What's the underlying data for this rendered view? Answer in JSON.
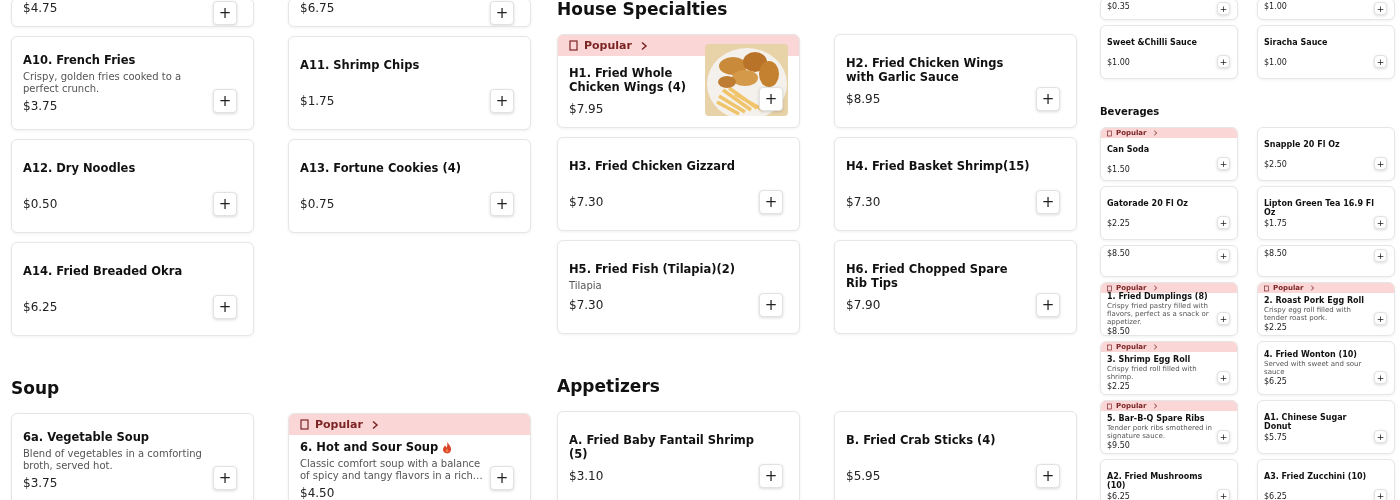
{
  "panels": [
    {
      "kind": "full",
      "sections": [
        {
          "items": [
            {
              "kind": "edge",
              "price": "$4.75",
              "button": "+"
            },
            {
              "kind": "edge",
              "price": "$6.75",
              "button": "+"
            },
            {
              "kind": "item",
              "name": "A10. French Fries",
              "description": "Crispy, golden fries cooked to a perfect crunch.",
              "price": "$3.75",
              "button": "+"
            },
            {
              "kind": "item",
              "name": "A11. Shrimp Chips",
              "price": "$1.75",
              "button": "+"
            },
            {
              "kind": "item",
              "name": "A12. Dry Noodles",
              "price": "$0.50",
              "button": "+"
            },
            {
              "kind": "item",
              "name": "A13. Fortune Cookies (4)",
              "price": "$0.75",
              "button": "+"
            },
            {
              "kind": "item",
              "name": "A14. Fried Breaded Okra",
              "price": "$6.25",
              "button": "+"
            }
          ]
        },
        {
          "heading": "Soup",
          "items": [
            {
              "name": "6a. Vegetable Soup",
              "description": "Blend of vegetables in a comforting broth, served hot.",
              "price": "$3.75",
              "button": "+"
            },
            {
              "badge": "Popular",
              "name": "6. Hot and Sour Soup",
              "spicy": true,
              "description": "Classic comfort soup with a balance of spicy and tangy flavors in a rich…",
              "price": "$4.50",
              "button": "+"
            }
          ]
        }
      ]
    },
    {
      "kind": "full",
      "sections": [
        {
          "heading": "House Specialties",
          "items": [
            {
              "badge": "Popular",
              "name": "H1. Fried Whole Chicken Wings (4)",
              "photo": true,
              "price": "$7.95",
              "button": "+"
            },
            {
              "name": "H2. Fried Chicken Wings with Garlic Sauce",
              "price": "$8.95",
              "button": "+"
            },
            {
              "name": "H3. Fried Chicken Gizzard",
              "price": "$7.30",
              "button": "+"
            },
            {
              "name": "H4. Fried Basket Shrimp(15)",
              "price": "$7.30",
              "button": "+"
            },
            {
              "name": "H5. Fried Fish (Tilapia)(2)",
              "description": "Tilapia",
              "price": "$7.30",
              "button": "+"
            },
            {
              "name": "H6. Fried Chopped Spare Rib Tips",
              "price": "$7.90",
              "button": "+"
            }
          ]
        },
        {
          "heading": "Appetizers",
          "items": [
            {
              "name": "A. Fried Baby Fantail Shrimp (5)",
              "price": "$3.10",
              "button": "+"
            },
            {
              "name": "B. Fried Crab Sticks (4)",
              "price": "$5.95",
              "button": "+"
            }
          ]
        }
      ]
    },
    {
      "kind": "compact",
      "sections": [
        {
          "items": [
            {
              "kind": "edge",
              "price": "$0.35",
              "button": "+"
            },
            {
              "kind": "edge",
              "price": "$1.00",
              "button": "+"
            },
            {
              "kind": "item",
              "name": "Sweet &Chilli Sauce",
              "price": "$1.00",
              "button": "+"
            },
            {
              "kind": "item",
              "name": "Siracha Sauce",
              "price": "$1.00",
              "button": "+"
            }
          ]
        },
        {
          "heading": "Beverages",
          "items": [
            {
              "kind": "item",
              "badge": "Popular",
              "name": "Can Soda",
              "price": "$1.50",
              "button": "+"
            },
            {
              "kind": "item",
              "name": "Snapple 20 Fl Oz",
              "price": "$2.50",
              "button": "+"
            },
            {
              "kind": "item",
              "name": "Gatorade 20 Fl Oz",
              "price": "$2.25",
              "button": "+"
            },
            {
              "kind": "item",
              "name": "Lipton Green Tea 16.9 Fl Oz",
              "price": "$1.75",
              "button": "+"
            },
            {
              "kind": "clipped",
              "price": "$8.50",
              "button": "+"
            },
            {
              "kind": "clipped",
              "price": "$8.50",
              "button": "+"
            },
            {
              "kind": "item",
              "badge": "Popular",
              "name": "1. Fried Dumplings (8)",
              "description": "Crispy fried pastry filled with flavors, perfect as a snack or appetizer.",
              "price": "$8.50",
              "button": "+"
            },
            {
              "kind": "item",
              "badge": "Popular",
              "name": "2. Roast Pork Egg Roll",
              "description": "Crispy egg roll filled with tender roast pork.",
              "price": "$2.25",
              "button": "+"
            },
            {
              "kind": "item",
              "badge": "Popular",
              "name": "3. Shrimp Egg Roll",
              "description": "Crispy fried roll filled with shrimp.",
              "price": "$2.25",
              "button": "+"
            },
            {
              "kind": "item",
              "name": "4. Fried Wonton (10)",
              "description": "Served with sweet and sour sauce",
              "price": "$6.25",
              "button": "+"
            },
            {
              "kind": "item",
              "badge": "Popular",
              "name": "5. Bar-B-Q Spare Ribs",
              "description": "Tender pork ribs smothered in signature sauce.",
              "price": "$9.50",
              "button": "+"
            },
            {
              "kind": "item",
              "name": "A1. Chinese Sugar Donut",
              "price": "$5.75",
              "button": "+"
            },
            {
              "kind": "item",
              "name": "A2. Fried Mushrooms (10)",
              "price": "$6.25",
              "button": "+"
            },
            {
              "kind": "item",
              "name": "A3. Fried Zucchini (10)",
              "price": "$6.25",
              "button": "+"
            }
          ]
        }
      ]
    }
  ]
}
